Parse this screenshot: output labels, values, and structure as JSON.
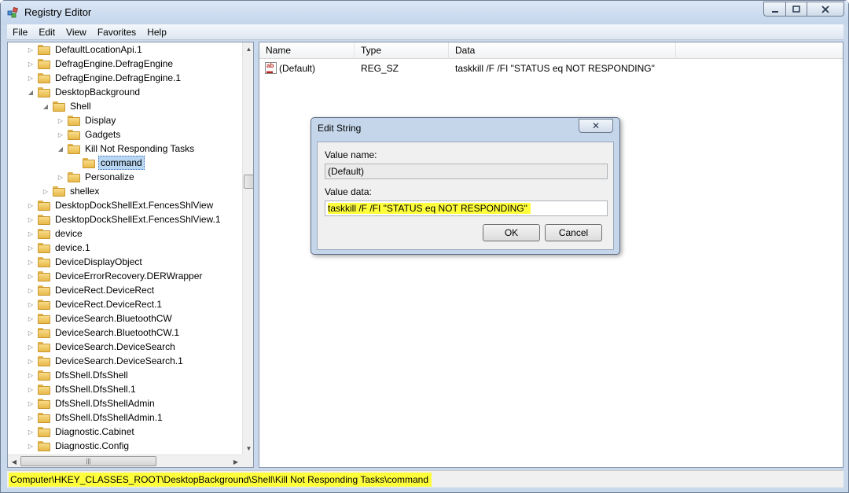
{
  "window": {
    "title": "Registry Editor"
  },
  "menu": [
    "File",
    "Edit",
    "View",
    "Favorites",
    "Help"
  ],
  "tree": [
    {
      "label": "DefaultLocationApi.1",
      "level": 0,
      "expander": "collapsed"
    },
    {
      "label": "DefragEngine.DefragEngine",
      "level": 0,
      "expander": "collapsed"
    },
    {
      "label": "DefragEngine.DefragEngine.1",
      "level": 0,
      "expander": "collapsed"
    },
    {
      "label": "DesktopBackground",
      "level": 0,
      "expander": "expanded"
    },
    {
      "label": "Shell",
      "level": 1,
      "expander": "expanded"
    },
    {
      "label": "Display",
      "level": 2,
      "expander": "collapsed"
    },
    {
      "label": "Gadgets",
      "level": 2,
      "expander": "collapsed"
    },
    {
      "label": "Kill Not Responding Tasks",
      "level": 2,
      "expander": "expanded"
    },
    {
      "label": "command",
      "level": 3,
      "expander": "none",
      "selected": true
    },
    {
      "label": "Personalize",
      "level": 2,
      "expander": "collapsed"
    },
    {
      "label": "shellex",
      "level": 1,
      "expander": "collapsed"
    },
    {
      "label": "DesktopDockShellExt.FencesShlView",
      "level": 0,
      "expander": "collapsed"
    },
    {
      "label": "DesktopDockShellExt.FencesShlView.1",
      "level": 0,
      "expander": "collapsed"
    },
    {
      "label": "device",
      "level": 0,
      "expander": "collapsed"
    },
    {
      "label": "device.1",
      "level": 0,
      "expander": "collapsed"
    },
    {
      "label": "DeviceDisplayObject",
      "level": 0,
      "expander": "collapsed"
    },
    {
      "label": "DeviceErrorRecovery.DERWrapper",
      "level": 0,
      "expander": "collapsed"
    },
    {
      "label": "DeviceRect.DeviceRect",
      "level": 0,
      "expander": "collapsed"
    },
    {
      "label": "DeviceRect.DeviceRect.1",
      "level": 0,
      "expander": "collapsed"
    },
    {
      "label": "DeviceSearch.BluetoothCW",
      "level": 0,
      "expander": "collapsed"
    },
    {
      "label": "DeviceSearch.BluetoothCW.1",
      "level": 0,
      "expander": "collapsed"
    },
    {
      "label": "DeviceSearch.DeviceSearch",
      "level": 0,
      "expander": "collapsed"
    },
    {
      "label": "DeviceSearch.DeviceSearch.1",
      "level": 0,
      "expander": "collapsed"
    },
    {
      "label": "DfsShell.DfsShell",
      "level": 0,
      "expander": "collapsed"
    },
    {
      "label": "DfsShell.DfsShell.1",
      "level": 0,
      "expander": "collapsed"
    },
    {
      "label": "DfsShell.DfsShellAdmin",
      "level": 0,
      "expander": "collapsed"
    },
    {
      "label": "DfsShell.DfsShellAdmin.1",
      "level": 0,
      "expander": "collapsed"
    },
    {
      "label": "Diagnostic.Cabinet",
      "level": 0,
      "expander": "collapsed"
    },
    {
      "label": "Diagnostic.Config",
      "level": 0,
      "expander": "collapsed"
    }
  ],
  "list": {
    "columns": {
      "name": "Name",
      "type": "Type",
      "data": "Data"
    },
    "rows": [
      {
        "icon": "reg-sz-icon",
        "name": "(Default)",
        "type": "REG_SZ",
        "data": "taskkill /F /FI \"STATUS eq NOT RESPONDING\""
      }
    ]
  },
  "dialog": {
    "title": "Edit String",
    "close_glyph": "✕",
    "value_name_label": "Value name:",
    "value_name": "(Default)",
    "value_data_label": "Value data:",
    "value_data": "taskkill /F /FI \"STATUS eq NOT RESPONDING\"",
    "ok_label": "OK",
    "cancel_label": "Cancel"
  },
  "statusbar": {
    "path": "Computer\\HKEY_CLASSES_ROOT\\DesktopBackground\\Shell\\Kill Not Responding Tasks\\command"
  },
  "colors": {
    "highlight": "#ffff3c",
    "selection": "#b9d7f2",
    "chrome": "#c9d8ea"
  }
}
